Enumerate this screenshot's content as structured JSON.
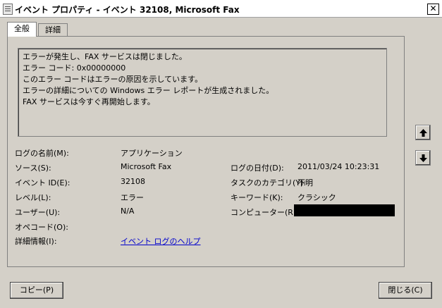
{
  "window": {
    "title": "イベント プロパティ - イベント 32108, Microsoft Fax",
    "close_glyph": "✕"
  },
  "tabs": [
    {
      "label": "全般"
    },
    {
      "label": "詳細"
    }
  ],
  "description": [
    "エラーが発生し、FAX サービスは閉じました。",
    "エラー コード: 0x00000000",
    "このエラー コードはエラーの原因を示しています。",
    "エラーの詳細についての Windows エラー レポートが生成されました。",
    "FAX サービスは今すぐ再開始します。"
  ],
  "fields": {
    "log_name_label": "ログの名前(M):",
    "log_name_value": "アプリケーション",
    "source_label": "ソース(S):",
    "source_value": "Microsoft Fax",
    "logged_label": "ログの日付(D):",
    "logged_value": "2011/03/24 10:23:31",
    "event_id_label": "イベント ID(E):",
    "event_id_value": "32108",
    "task_category_label": "タスクのカテゴリ(Y):",
    "task_category_value": "不明",
    "level_label": "レベル(L):",
    "level_value": "エラー",
    "keywords_label": "キーワード(K):",
    "keywords_value": "クラシック",
    "user_label": "ユーザー(U):",
    "user_value": "N/A",
    "computer_label": "コンピューター(R):",
    "opcode_label": "オペコード(O):",
    "more_info_label": "詳細情報(I):",
    "more_info_link": "イベント ログのヘルプ"
  },
  "buttons": {
    "copy": "コピー(P)",
    "close": "閉じる(C)"
  },
  "icons": {
    "up": "arrow-up-icon",
    "down": "arrow-down-icon"
  }
}
